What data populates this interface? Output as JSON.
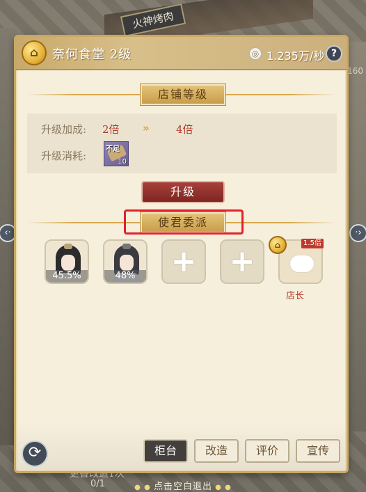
{
  "background": {
    "sign_text": "火神烤肉",
    "side_number": "160",
    "bottom_text": "更香改造1次",
    "bottom_count": "0/1",
    "hint": "点击空白退出"
  },
  "header": {
    "coin_icon": "coin-icon",
    "title": "奈何食堂  2级",
    "income_icon": "silver-icon",
    "income": "1.235万/秒",
    "help_label": "?"
  },
  "shop_level": {
    "banner": "店铺等级",
    "bonus_label": "升级加成:",
    "bonus_current": "2倍",
    "bonus_arrow": "»",
    "bonus_next": "4倍",
    "cost_label": "升级消耗:",
    "cost_item": {
      "badge": "不足",
      "count": "10",
      "icon": "scroll-icon"
    },
    "upgrade_button": "升级"
  },
  "assignment": {
    "banner": "使君委派",
    "slots": [
      {
        "type": "staff",
        "percent": "45.5%"
      },
      {
        "type": "staff",
        "percent": "48%"
      },
      {
        "type": "empty",
        "plus": "+"
      },
      {
        "type": "empty",
        "plus": "+"
      }
    ],
    "manager": {
      "label": "店长",
      "multiplier": "1.5倍",
      "coin_icon": "coin-icon"
    }
  },
  "nav": {
    "left_arrow": "‹·",
    "right_arrow": "·›"
  },
  "bottom_tabs": [
    {
      "label": "柜台",
      "active": true
    },
    {
      "label": "改造",
      "active": false
    },
    {
      "label": "评价",
      "active": false
    },
    {
      "label": "宣传",
      "active": false
    }
  ],
  "colors": {
    "panel_bg": "#f6efdc",
    "accent_gold": "#c99d49",
    "value_red": "#b33a2b",
    "highlight_red": "#e1212c",
    "active_tab": "#433f3c"
  }
}
